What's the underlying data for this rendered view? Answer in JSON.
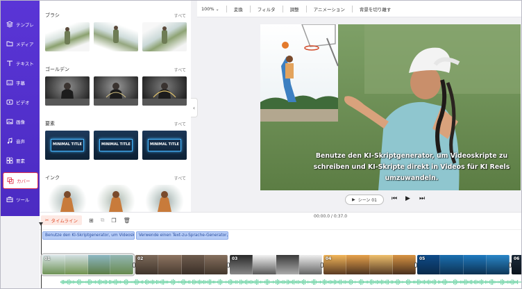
{
  "sidebar": {
    "items": [
      {
        "label": "テンプレ",
        "icon": "layers-icon"
      },
      {
        "label": "メディア",
        "icon": "folder-icon"
      },
      {
        "label": "テキスト",
        "icon": "text-icon"
      },
      {
        "label": "字幕",
        "icon": "subtitle-icon"
      },
      {
        "label": "ビデオ",
        "icon": "video-icon"
      },
      {
        "label": "画像",
        "icon": "image-icon"
      },
      {
        "label": "音声",
        "icon": "music-icon"
      },
      {
        "label": "要素",
        "icon": "shapes-icon"
      },
      {
        "label": "カバー",
        "icon": "cover-icon"
      },
      {
        "label": "ツール",
        "icon": "toolbox-icon"
      }
    ],
    "active_index": 8
  },
  "panel": {
    "more_label": "すべて",
    "sections": [
      {
        "title": "ブラシ"
      },
      {
        "title": "ゴールデン"
      },
      {
        "title": "要素",
        "thumb_text": "MINIMAL TITLE"
      },
      {
        "title": "インク"
      }
    ]
  },
  "toolbar": {
    "zoom": "100%",
    "items": [
      "変換",
      "フィルタ",
      "調整",
      "アニメーション",
      "背景を切り離す"
    ]
  },
  "preview": {
    "subtitle": "Benutze den KI-Skriptgenerator, um Videoskripte zu schreiben und KI-Skripte direkt in Videos für KI Reels umzuwandeln."
  },
  "controls": {
    "scene_label": "シーン 01"
  },
  "timeline": {
    "time_display": "00:00.0 / 0:37.0",
    "timeline_label": "タイムライン",
    "captions": [
      "Benutze den KI-Skriptgenerator, um Videosk...",
      "Verwende einen Text-zu-Sprache-Generator, ..."
    ],
    "clips": [
      "01",
      "02",
      "03",
      "04",
      "05",
      "06"
    ]
  },
  "colors": {
    "nav_bg": "#5a35d6",
    "accent_red": "#e2334c",
    "caption_blue": "#b7cdf7",
    "audio_green": "#6fd3a6"
  }
}
